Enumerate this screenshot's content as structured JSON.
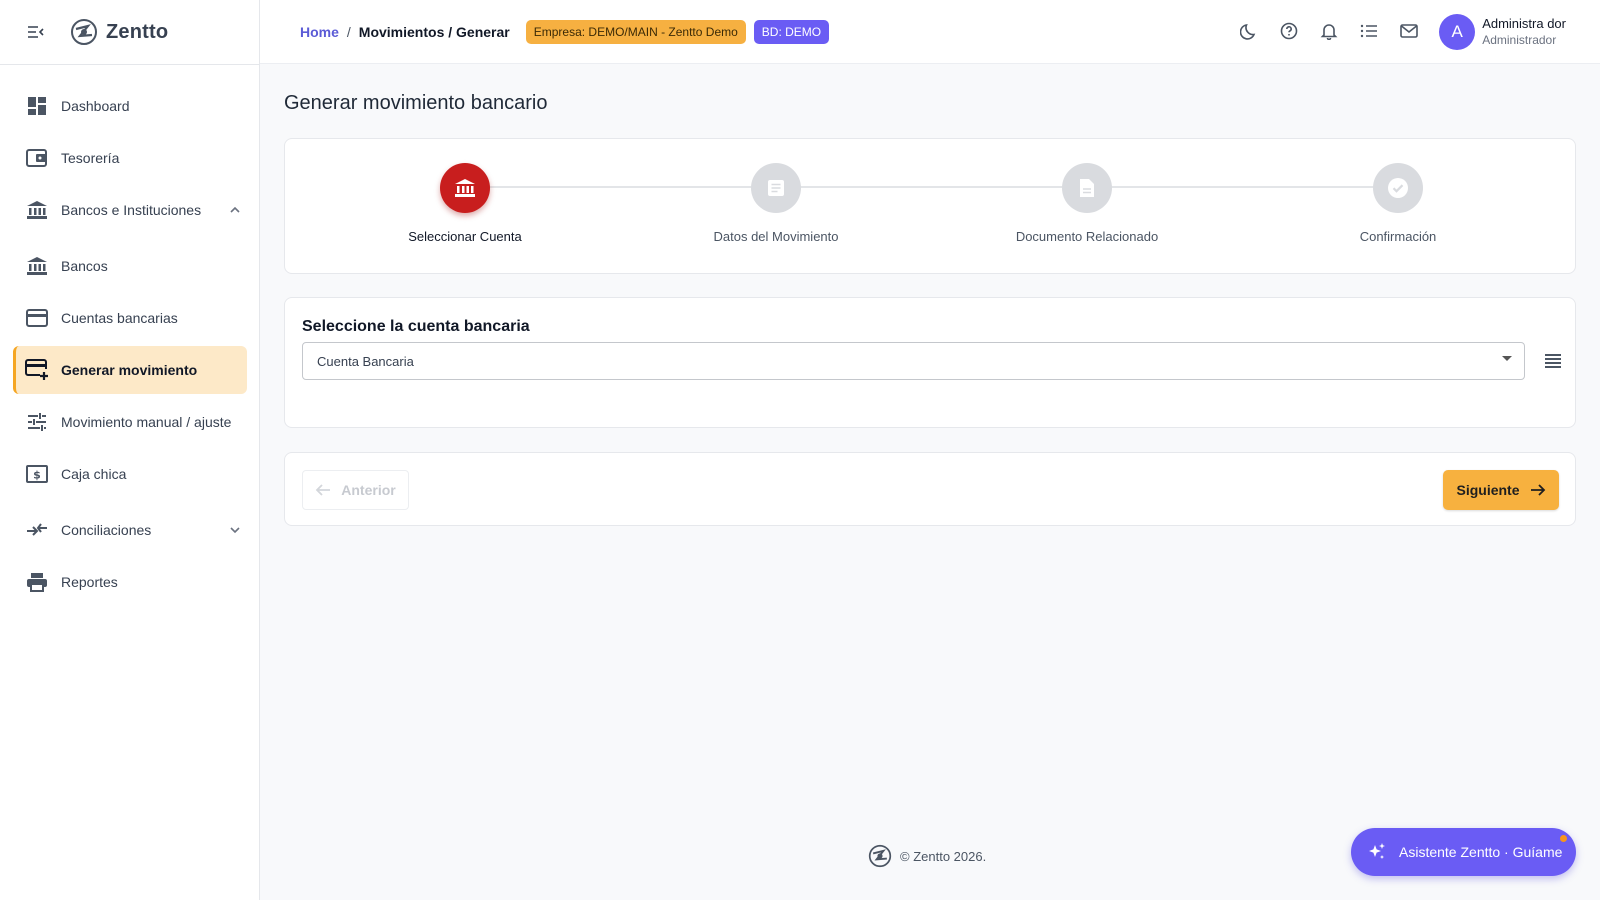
{
  "app": {
    "name": "Zentto"
  },
  "sidebar": {
    "items": [
      {
        "label": "Dashboard",
        "icon": "dashboard-icon"
      },
      {
        "label": "Tesorería",
        "icon": "wallet-icon"
      },
      {
        "label": "Bancos e Instituciones",
        "icon": "bank-icon",
        "expandable": "expanded"
      },
      {
        "label": "Bancos",
        "icon": "bank-icon"
      },
      {
        "label": "Cuentas bancarias",
        "icon": "credit-card-icon"
      },
      {
        "label": "Generar movimiento",
        "icon": "card-add-icon",
        "active": true
      },
      {
        "label": "Movimiento manual / ajuste",
        "icon": "tune-icon"
      },
      {
        "label": "Caja chica",
        "icon": "cash-icon"
      },
      {
        "label": "Conciliaciones",
        "icon": "compare-icon",
        "expandable": "collapsed"
      },
      {
        "label": "Reportes",
        "icon": "print-icon"
      }
    ]
  },
  "header": {
    "breadcrumb": {
      "home": "Home",
      "separator": "/",
      "current": "Movimientos / Generar"
    },
    "empresa_badge": "Empresa: DEMO/MAIN - Zentto Demo",
    "bd_badge": "BD: DEMO",
    "icons": [
      "moon-icon",
      "help-icon",
      "bell-icon",
      "list-icon",
      "mail-icon"
    ],
    "user": {
      "initial": "A",
      "name": "Administra dor",
      "role": "Administrador"
    }
  },
  "main": {
    "title": "Generar movimiento bancario",
    "steps": [
      {
        "label": "Seleccionar Cuenta",
        "icon": "bank-icon",
        "active": true
      },
      {
        "label": "Datos del Movimiento",
        "icon": "notes-icon",
        "active": false
      },
      {
        "label": "Documento Relacionado",
        "icon": "document-icon",
        "active": false
      },
      {
        "label": "Confirmación",
        "icon": "check-icon",
        "active": false
      }
    ],
    "select_title": "Seleccione la cuenta bancaria",
    "select_placeholder": "Cuenta Bancaria",
    "prev_label": "Anterior",
    "next_label": "Siguiente"
  },
  "footer": {
    "text": "© Zentto 2026."
  },
  "assistant": {
    "label": "Asistente Zentto · Guíame"
  },
  "colors": {
    "primary": "#6a5cf4",
    "accent": "#f7b13f",
    "active_step": "#c81e1e",
    "active_nav_bg": "#fde9c8"
  }
}
